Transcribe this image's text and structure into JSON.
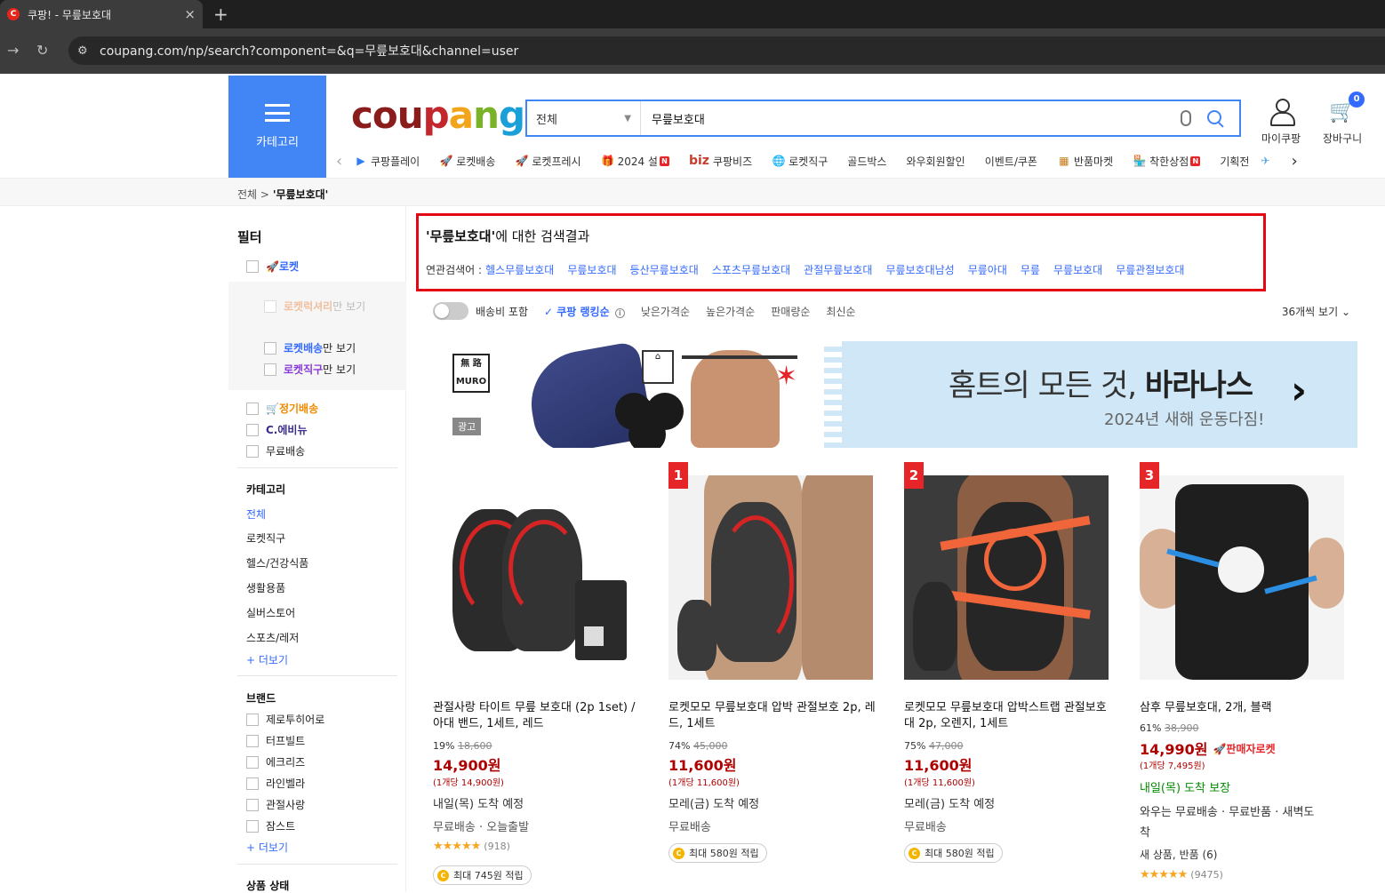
{
  "browser": {
    "tab_title": "쿠팡! - 무릎보호대",
    "favicon": "C",
    "tab_close": "×",
    "new_tab": "+",
    "url": "coupang.com/np/search?component=&q=무릎보호대&channel=user"
  },
  "header": {
    "category_label": "카테고리",
    "logo": [
      "cou",
      "p",
      "a",
      "n",
      "g"
    ],
    "search_category": "전체",
    "search_value": "무릎보호대",
    "my_coupang": "마이쿠팡",
    "cart": "장바구니",
    "cart_count": "0",
    "shortcuts": [
      {
        "label": "쿠팡플레이",
        "icon": "play-icon"
      },
      {
        "label": "로켓배송",
        "icon": "rocket-icon"
      },
      {
        "label": "로켓프레시",
        "icon": "rocket-fresh-icon"
      },
      {
        "label": "2024 설",
        "icon": "gift-icon",
        "badge": "N"
      },
      {
        "label": "쿠팡비즈",
        "icon": "biz-icon",
        "prefix": "biz"
      },
      {
        "label": "로켓직구",
        "icon": "globe-rocket-icon"
      },
      {
        "label": "골드박스",
        "icon": ""
      },
      {
        "label": "와우회원할인",
        "icon": ""
      },
      {
        "label": "이벤트/쿠폰",
        "icon": ""
      },
      {
        "label": "반품마켓",
        "icon": "market-icon"
      },
      {
        "label": "착한상점",
        "icon": "store-icon",
        "badge": "N"
      },
      {
        "label": "기획전",
        "icon": ""
      }
    ]
  },
  "breadcrumb": {
    "root": "전체",
    "sep": ">",
    "current": "'무릎보호대'"
  },
  "filter": {
    "title": "필터",
    "rocket": "로켓",
    "rocket_luxury": "로켓럭셔리",
    "rocket_luxury_suffix": "만 보기",
    "rocket_delivery": "로켓배송",
    "rocket_delivery_suffix": "만 보기",
    "rocket_direct": "로켓직구",
    "rocket_direct_suffix": "만 보기",
    "subscription": "정기배송",
    "c_avenue": "C.에비뉴",
    "free_shipping": "무료배송",
    "category_title": "카테고리",
    "categories": [
      "전체",
      "로켓직구",
      "헬스/건강식품",
      "생활용품",
      "실버스토어",
      "스포츠/레저"
    ],
    "more": "+ 더보기",
    "brand_title": "브랜드",
    "brands": [
      "제로투히어로",
      "터프빌트",
      "에크리즈",
      "라인벨라",
      "관절사랑",
      "잠스트"
    ],
    "condition_title": "상품 상태"
  },
  "result": {
    "query": "'무릎보호대'",
    "suffix": "에 대한 검색결과",
    "related_label": "연관검색어 :",
    "related": [
      "헬스무릎보호대",
      "무릎보호대",
      "등산무릎보호대",
      "스포츠무릎보호대",
      "관절무릎보호대",
      "무릎보호대남성",
      "무릎아대",
      "무릎",
      "무릎보호대",
      "무릎관절보호대"
    ]
  },
  "sort": {
    "shipping_toggle": "배송비 포함",
    "options": [
      "쿠팡 랭킹순",
      "낮은가격순",
      "높은가격순",
      "판매량순",
      "최신순"
    ],
    "info": "i",
    "per_page": "36개씩 보기"
  },
  "banner": {
    "brand_mark": [
      "無 路",
      "MURO"
    ],
    "ad_label": "광고",
    "headline": "홈트의 모든 것,",
    "headline_bold": "바라나스",
    "subline": "2024년 새해 운동다짐!",
    "arrow": "›"
  },
  "products": [
    {
      "rank": "",
      "title": "관절사랑 타이트 무릎 보호대 (2p 1set) / 아대 밴드, 1세트, 레드",
      "discount": "19%",
      "original": "18,600",
      "price": "14,900원",
      "unit": "(1개당 14,900원)",
      "arrival": "내일(목) 도착 예정",
      "shipping": "무료배송 · 오늘출발",
      "stars": "★★★★★",
      "reviews": "(918)",
      "reward": "최대 745원 적립"
    },
    {
      "rank": "1",
      "title": "로켓모모 무릎보호대 압박 관절보호 2p, 레드, 1세트",
      "discount": "74%",
      "original": "45,000",
      "price": "11,600원",
      "unit": "(1개당 11,600원)",
      "arrival": "모레(금) 도착 예정",
      "shipping": "무료배송",
      "reward": "최대 580원 적립"
    },
    {
      "rank": "2",
      "title": "로켓모모 무릎보호대 압박스트랩 관절보호대 2p, 오렌지, 1세트",
      "discount": "75%",
      "original": "47,000",
      "price": "11,600원",
      "unit": "(1개당 11,600원)",
      "arrival": "모레(금) 도착 예정",
      "shipping": "무료배송",
      "reward": "최대 580원 적립"
    },
    {
      "rank": "3",
      "title": "삼후 무릎보호대, 2개, 블랙",
      "discount": "61%",
      "original": "38,900",
      "price": "14,990원",
      "seller_rocket": "판매자로켓",
      "unit": "(1개당 7,495원)",
      "arrival": "내일(목) 도착 보장",
      "shipping": "와우는 무료배송 · 무료반품 · 새벽도착",
      "new_item": "새 상품, 반품 (6)",
      "stars": "★★★★★",
      "reviews": "(9475)"
    }
  ],
  "colors": {
    "accent": "#346aff",
    "category_bg": "#4285f4",
    "price": "#ae0000",
    "highlight_border": "#e30613"
  }
}
